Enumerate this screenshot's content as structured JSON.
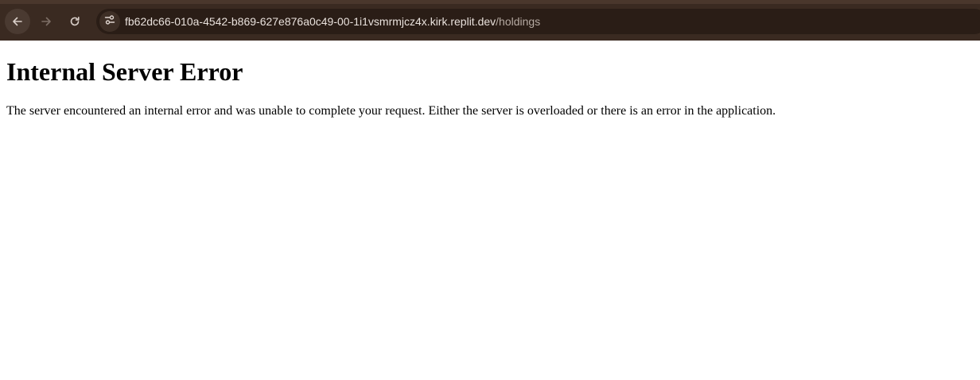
{
  "browser": {
    "url_host": "fb62dc66-010a-4542-b869-627e876a0c49-00-1i1vsmrmjcz4x.kirk.replit.dev",
    "url_path": "/holdings",
    "icons": {
      "back": "arrow-left-icon",
      "forward": "arrow-right-icon",
      "reload": "reload-icon",
      "site_info": "tune-icon"
    },
    "colors": {
      "toolbar": "#3a2a21",
      "omnibox": "#2a1d16",
      "url_text": "#e9e1dc",
      "url_path": "#b6aaa2"
    }
  },
  "page": {
    "heading": "Internal Server Error",
    "message": "The server encountered an internal error and was unable to complete your request. Either the server is overloaded or there is an error in the application."
  }
}
